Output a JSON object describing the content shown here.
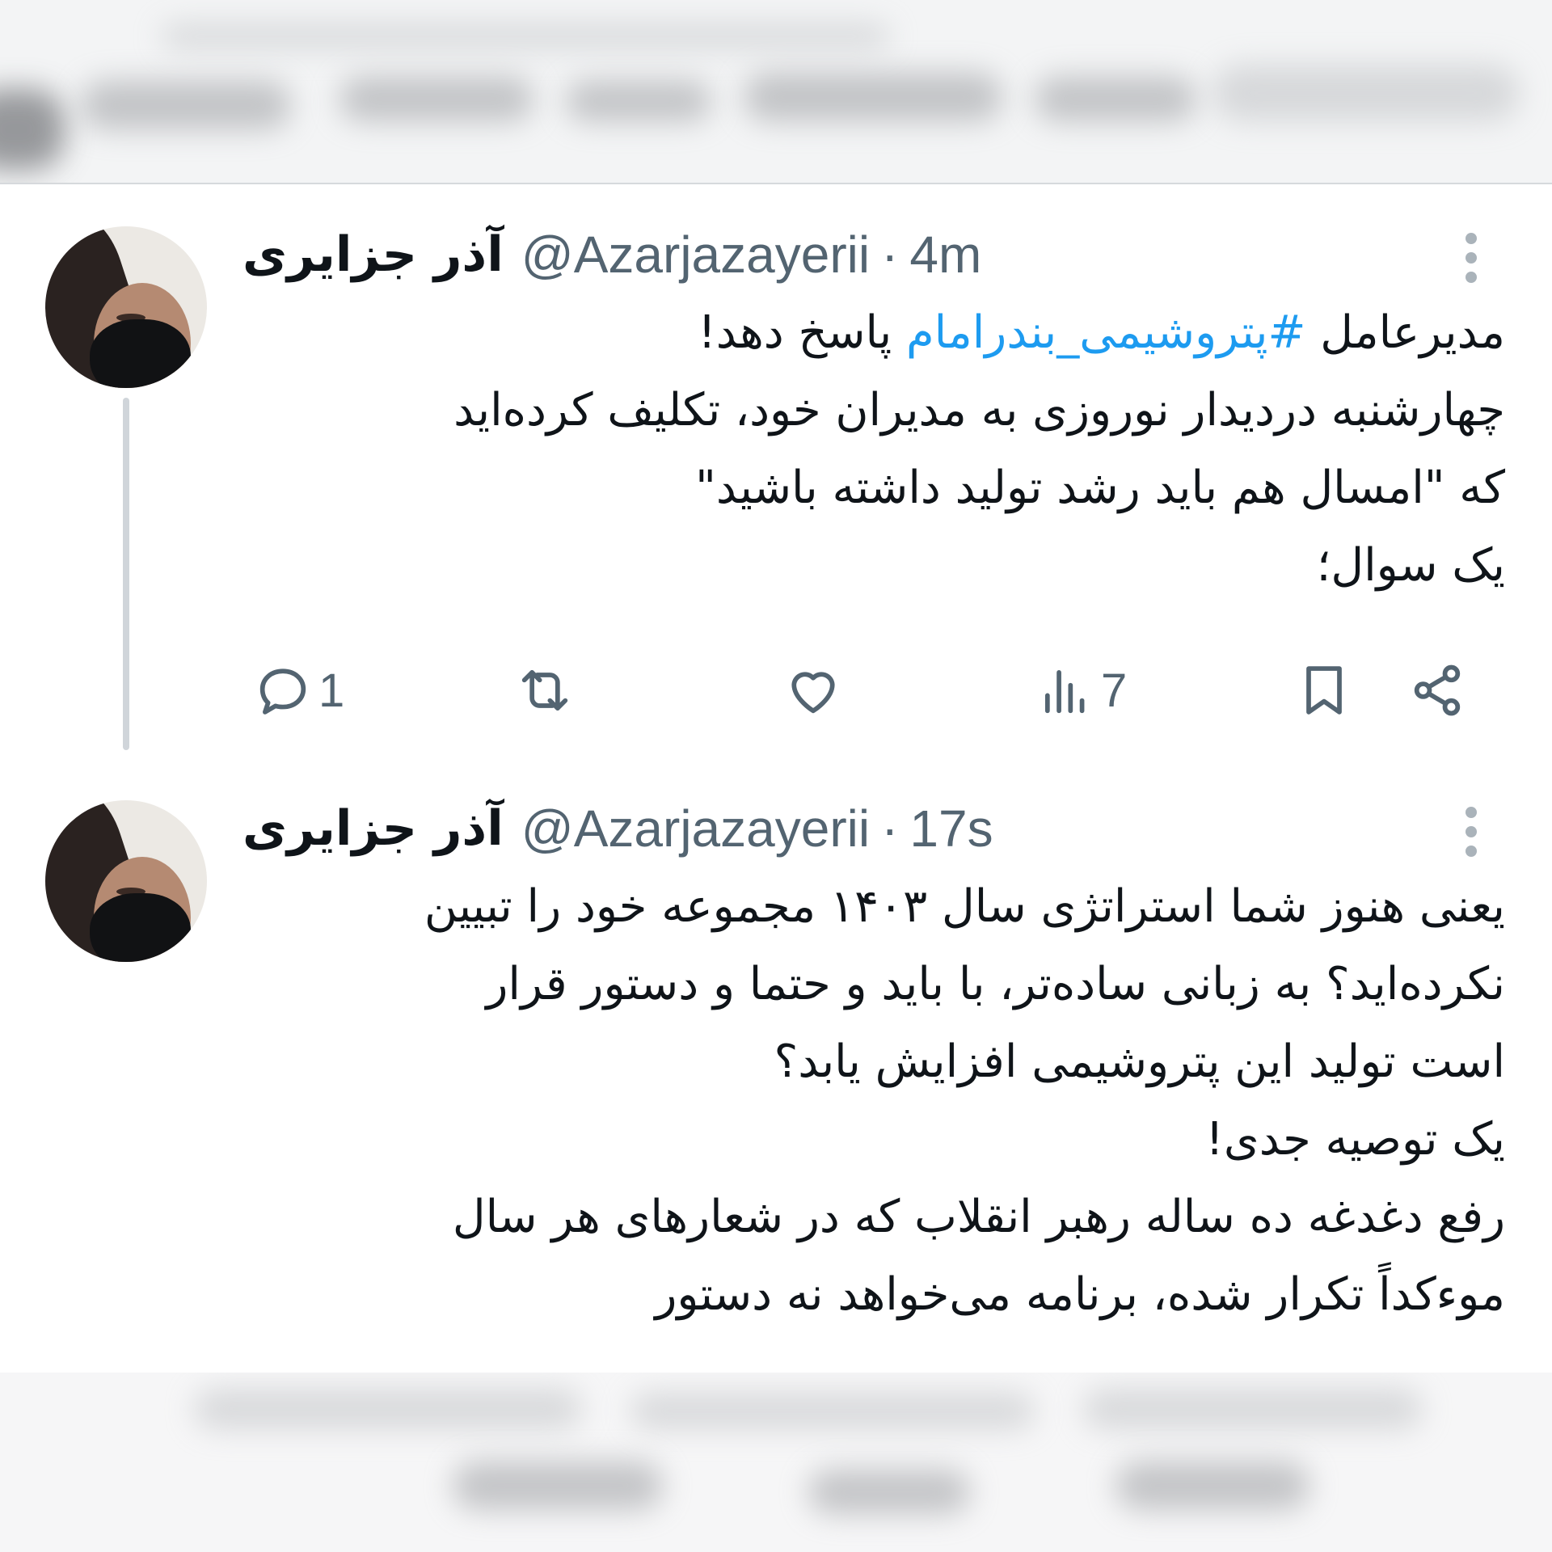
{
  "tweets": [
    {
      "display_name": "آذر جزایری",
      "handle": "@Azarjazayerii",
      "separator": "·",
      "time": "4m",
      "lines": [
        {
          "before": "مدیرعامل ",
          "hashtag": "#پتروشیمی_بندرامام",
          "after": " پاسخ دهد!"
        },
        {
          "text": "چهارشنبه دردیدار نوروزی به مدیران خود، تکلیف کرده‌اید"
        },
        {
          "text": "که \"امسال هم باید رشد تولید داشته باشید\""
        },
        {
          "text": "یک سوال؛"
        }
      ],
      "actions": {
        "reply_count": "1",
        "retweet_count": "",
        "like_count": "",
        "views_count": "7"
      }
    },
    {
      "display_name": "آذر جزایری",
      "handle": "@Azarjazayerii",
      "separator": "·",
      "time": "17s",
      "lines": [
        {
          "text": "یعنی هنوز شما استراتژی سال ۱۴۰۳ مجموعه خود را تبیین"
        },
        {
          "text": "نکرده‌اید؟ به زبانی ساده‌تر، با باید و حتما و دستور قرار"
        },
        {
          "text": "است تولید این پتروشیمی افزایش یابد؟"
        },
        {
          "text": "یک توصیه جدی!"
        },
        {
          "text": "رفع دغدغه ده ساله رهبر انقلاب که در شعارهای هر سال"
        },
        {
          "text": "موءکداً تکرار شده، برنامه می‌خواهد نه دستور"
        }
      ]
    }
  ],
  "colors": {
    "hashtag": "#1d9bf0",
    "secondary_text": "#536471",
    "primary_text": "#0f1419",
    "thread_line": "#d0d5da"
  },
  "icons": {
    "reply": "reply-icon",
    "retweet": "retweet-icon",
    "like": "heart-icon",
    "views": "views-icon",
    "bookmark": "bookmark-icon",
    "share": "share-icon",
    "more": "more-vertical-icon"
  }
}
